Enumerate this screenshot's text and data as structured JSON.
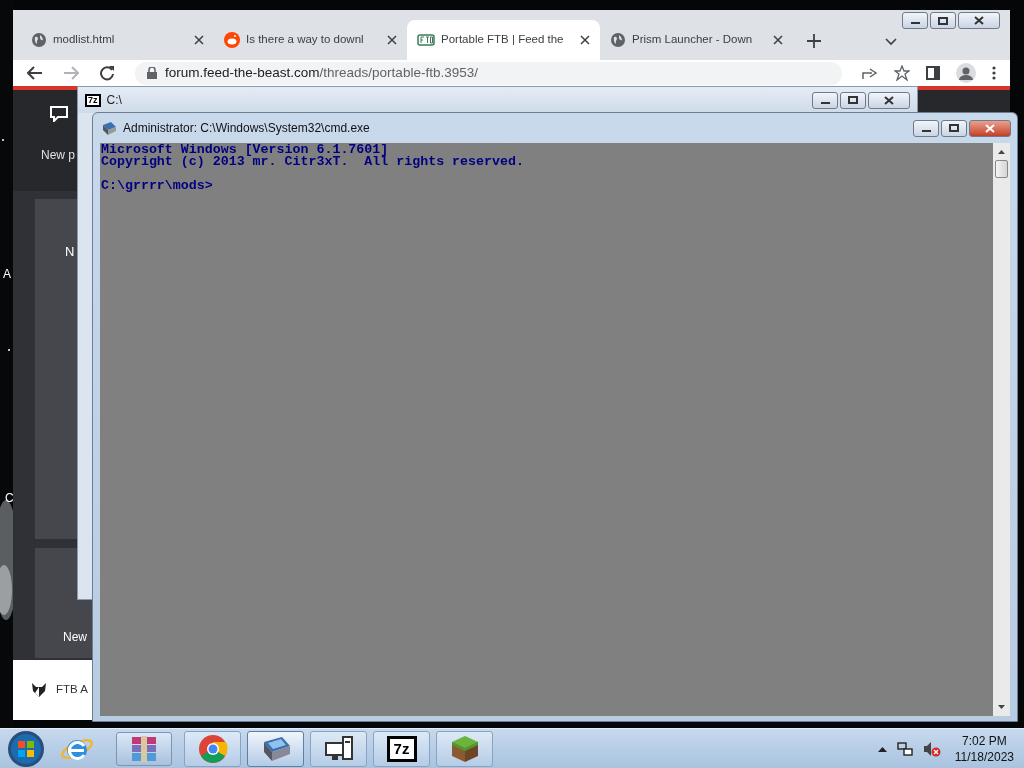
{
  "desktop": {
    "labels": [
      "A",
      "C"
    ]
  },
  "browser": {
    "tabs": [
      {
        "title": "modlist.html",
        "kind": "globe",
        "selected": false
      },
      {
        "title": "Is there a way to downl",
        "kind": "reddit",
        "selected": false
      },
      {
        "title": "Portable FTB | Feed the",
        "kind": "ftb",
        "selected": true
      },
      {
        "title": "Prism Launcher - Down",
        "kind": "globe",
        "selected": false
      }
    ],
    "url_domain": "forum.feed-the-beast.com",
    "url_path": "/threads/portable-ftb.3953/",
    "page_texts": [
      "New p",
      "N",
      "New"
    ],
    "footer": "FTB A"
  },
  "archiver_window": {
    "icon_label": "7z",
    "title": "C:\\"
  },
  "console": {
    "title": "Administrator: C:\\Windows\\System32\\cmd.exe",
    "output": [
      "Microsoft Windows [Version 6.1.7601]",
      "Copyright (c) 2013 mr. Citr3xT.  All rights reserved."
    ],
    "prompt": "C:\\grrrr\\mods>"
  },
  "taskbar": {
    "pinned": [
      {
        "kind": "ie"
      },
      {
        "kind": "archive"
      }
    ],
    "items": [
      {
        "kind": "chrome",
        "selected": false
      },
      {
        "kind": "console",
        "selected": true
      },
      {
        "kind": "computer",
        "selected": false
      },
      {
        "kind": "sevenzip",
        "label": "7z",
        "selected": false
      },
      {
        "kind": "block",
        "selected": false
      }
    ],
    "clock": {
      "time": "7:02 PM",
      "date": "11/18/2023"
    }
  }
}
